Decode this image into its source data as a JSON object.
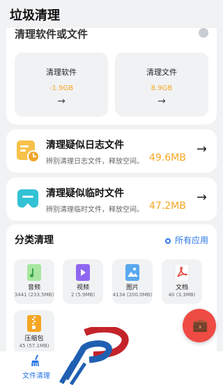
{
  "header": {
    "title": "垃圾清理"
  },
  "top_card": {
    "title": "清理软件或文件",
    "tiles": [
      {
        "label": "清理软件",
        "value": "-1.9GB",
        "arrow": "→"
      },
      {
        "label": "清理文件",
        "value": "8.9GB",
        "arrow": "→"
      }
    ]
  },
  "rows": [
    {
      "title": "清理疑似日志文件",
      "subtitle": "辨别清理日志文件，释放空间。",
      "size": "49.6MB",
      "arrow": "→"
    },
    {
      "title": "清理疑似临时文件",
      "subtitle": "辨别清理临时文件，释放空间。",
      "size": "47.2MB",
      "arrow": "→"
    }
  ],
  "categories": {
    "title": "分类清理",
    "all_apps": "所有应用",
    "items": [
      {
        "name": "音频",
        "count": "3441 (233.5MB)"
      },
      {
        "name": "视频",
        "count": "2 (5.9MB)"
      },
      {
        "name": "图片",
        "count": "4134 (200.0MB)"
      },
      {
        "name": "文档",
        "count": "40 (3.3MB)"
      },
      {
        "name": "压缩包",
        "count": "45 (57.1MB)"
      }
    ]
  },
  "nav": {
    "label": "文件清理"
  },
  "colors": {
    "accent": "#2a76e6",
    "size_orange": "#f5a623",
    "fab_red": "#ef4b45"
  }
}
